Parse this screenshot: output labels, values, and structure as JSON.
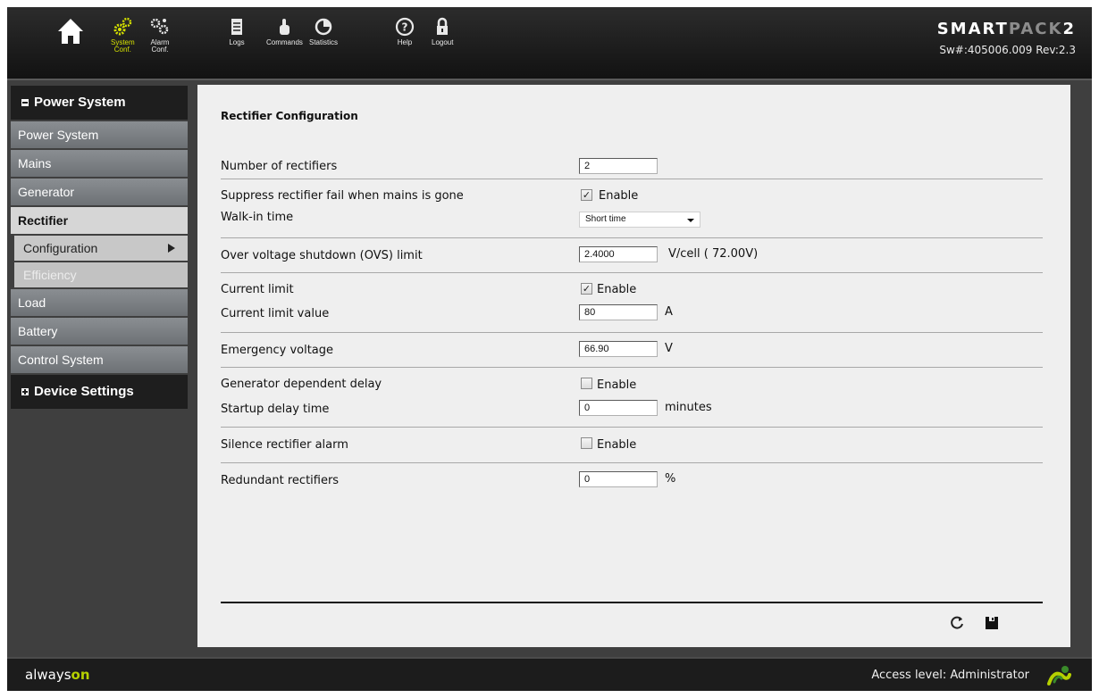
{
  "nav": {
    "items": [
      {
        "icon": "home-icon",
        "label_lines": [
          "",
          ""
        ]
      },
      {
        "icon": "system-conf-icon",
        "label_lines": [
          "System",
          "Conf."
        ]
      },
      {
        "icon": "alarm-conf-icon",
        "label_lines": [
          "Alarm",
          "Conf."
        ]
      },
      {
        "icon": "logs-icon",
        "label_lines": [
          "Logs",
          ""
        ]
      },
      {
        "icon": "commands-icon",
        "label_lines": [
          "Commands",
          ""
        ]
      },
      {
        "icon": "statistics-icon",
        "label_lines": [
          "Statistics",
          ""
        ]
      },
      {
        "icon": "help-icon",
        "label_lines": [
          "Help",
          ""
        ]
      },
      {
        "icon": "logout-icon",
        "label_lines": [
          "Logout",
          ""
        ]
      }
    ]
  },
  "brand": {
    "logo_main": "SMART",
    "logo_accent": "PACK",
    "logo_suffix": "2",
    "sw": "Sw#:405006.009 Rev:2.3"
  },
  "sidebar": {
    "section1": "Power System",
    "items": [
      "Power System",
      "Mains",
      "Generator",
      "Rectifier"
    ],
    "sub_items": [
      "Configuration",
      "Efficiency"
    ],
    "items_after": [
      "Load",
      "Battery",
      "Control System"
    ],
    "section2": "Device Settings"
  },
  "main": {
    "title": "Rectifier Configuration",
    "num_rectifiers": {
      "label": "Number of rectifiers",
      "value": "2"
    },
    "suppress_fail": {
      "label": "Suppress rectifier fail when mains is gone",
      "checked": true,
      "check_label": "Enable"
    },
    "walk_in": {
      "label": "Walk-in time",
      "value": "Short time"
    },
    "ovs": {
      "label": "Over voltage shutdown (OVS) limit",
      "value": "2.4000",
      "unit": "V/cell ( 72.00V)"
    },
    "current_limit": {
      "label": "Current limit",
      "checked": true,
      "check_label": "Enable"
    },
    "current_limit_value": {
      "label": "Current limit value",
      "value": "80",
      "unit": "A"
    },
    "emergency_voltage": {
      "label": "Emergency voltage",
      "value": "66.90",
      "unit": "V"
    },
    "gen_delay": {
      "label": "Generator dependent delay",
      "checked": false,
      "check_label": "Enable"
    },
    "startup_delay": {
      "label": "Startup delay time",
      "value": "0",
      "unit": "minutes"
    },
    "silence_alarm": {
      "label": "Silence rectifier alarm",
      "checked": false,
      "check_label": "Enable"
    },
    "redundant": {
      "label": "Redundant rectifiers",
      "value": "0",
      "unit": "%"
    }
  },
  "footer": {
    "always": "always",
    "on": "on",
    "access": "Access level: Administrator"
  },
  "colors": {
    "accent": "#d4e000",
    "brand_green": "#b5d000"
  }
}
